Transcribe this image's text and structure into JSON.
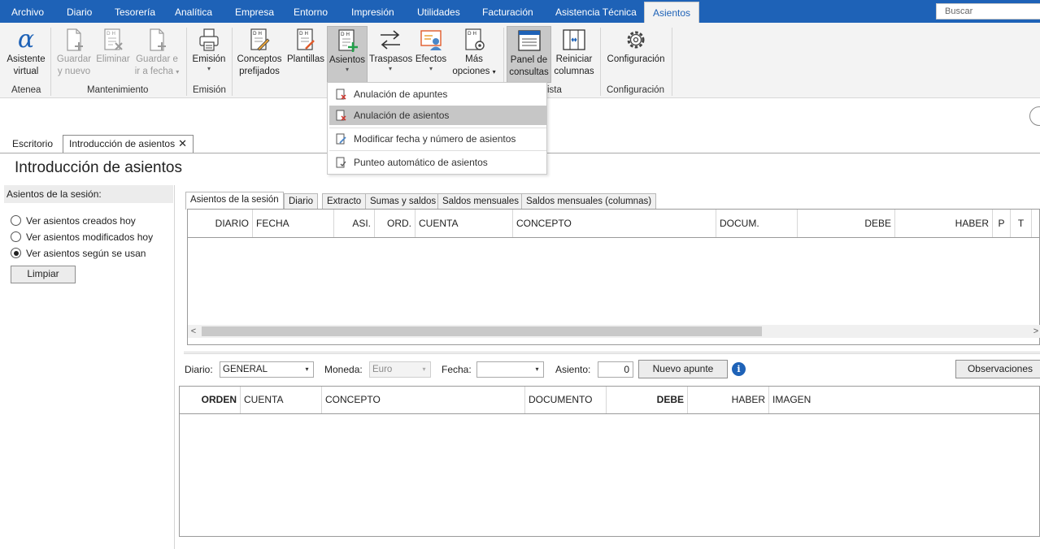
{
  "menubar": {
    "items": [
      "Archivo",
      "Diario",
      "Tesorería",
      "Analítica",
      "Empresa",
      "Entorno",
      "Impresión",
      "Utilidades",
      "Facturación",
      "Asistencia Técnica",
      "Asientos"
    ],
    "active": "Asientos",
    "search_placeholder": "Buscar"
  },
  "ribbon": {
    "buttons": {
      "asistente": [
        "Asistente",
        "virtual"
      ],
      "guardar_nuevo": [
        "Guardar",
        "y nuevo"
      ],
      "eliminar": [
        "Eliminar"
      ],
      "guardar_fecha": [
        "Guardar e",
        "ir a fecha"
      ],
      "emision": [
        "Emisión"
      ],
      "conceptos": [
        "Conceptos",
        "prefijados"
      ],
      "plantillas": [
        "Plantillas"
      ],
      "asientos": [
        "Asientos"
      ],
      "traspasos": [
        "Traspasos"
      ],
      "efectos": [
        "Efectos"
      ],
      "mas_opciones": [
        "Más",
        "opciones"
      ],
      "panel": [
        "Panel de",
        "consultas"
      ],
      "reiniciar": [
        "Reiniciar",
        "columnas"
      ],
      "configuracion": [
        "Configuración"
      ]
    },
    "groups": {
      "atenea": "Atenea",
      "mantenimiento": "Mantenimiento",
      "emision": "Emisión",
      "vista": "ista",
      "configuracion": "Configuración"
    }
  },
  "dropdown": {
    "items": [
      "Anulación de apuntes",
      "Anulación de asientos",
      "Modificar fecha y número de asientos",
      "Punteo automático de asientos"
    ],
    "highlighted": "Anulación de asientos"
  },
  "doc_tabs": [
    "Escritorio",
    "Introducción de asientos"
  ],
  "page_title": "Introducción de asientos",
  "left_panel": {
    "header": "Asientos de la sesión:",
    "options": [
      "Ver asientos creados hoy",
      "Ver asientos modificados hoy",
      "Ver asientos según se usan"
    ],
    "selected": "Ver asientos según se usan",
    "clear_button": "Limpiar"
  },
  "panel_tabs": [
    "Asientos de la sesión",
    "Diario",
    "Extracto",
    "Sumas y saldos",
    "Saldos mensuales",
    "Saldos mensuales (columnas)"
  ],
  "grid1_columns": [
    "DIARIO",
    "FECHA",
    "ASI.",
    "ORD.",
    "CUENTA",
    "CONCEPTO",
    "DOCUM.",
    "DEBE",
    "HABER",
    "P",
    "T"
  ],
  "form": {
    "diario_label": "Diario:",
    "diario_value": "GENERAL",
    "moneda_label": "Moneda:",
    "moneda_value": "Euro",
    "fecha_label": "Fecha:",
    "fecha_value": "",
    "asiento_label": "Asiento:",
    "asiento_value": "0",
    "nuevo_apunte": "Nuevo apunte",
    "info": "i",
    "observaciones": "Observaciones"
  },
  "grid2_columns": [
    "ORDEN",
    "CUENTA",
    "CONCEPTO",
    "DOCUMENTO",
    "DEBE",
    "HABER",
    "IMAGEN"
  ],
  "glyphs": {
    "caret": "▾",
    "close": "✕",
    "left_arrow": "<",
    "right_arrow": ">",
    "atenea_symbol": "α"
  }
}
